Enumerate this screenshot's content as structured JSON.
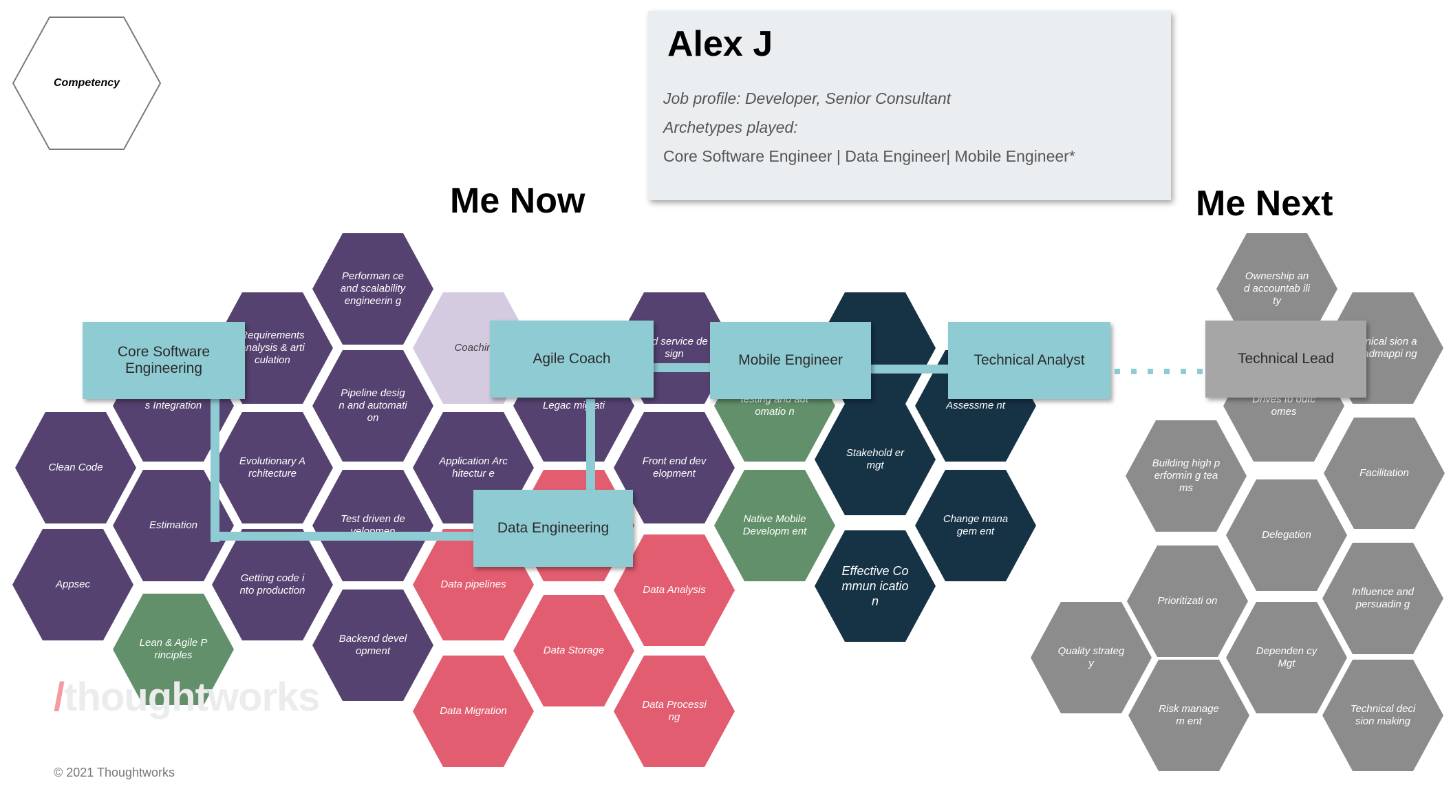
{
  "legend": {
    "label": "Competency"
  },
  "profile": {
    "name": "Alex J",
    "job_profile": "Job profile: Developer, Senior Consultant",
    "archetypes_label": "Archetypes played:",
    "archetypes": "Core Software Engineer | Data Engineer| Mobile Engineer*"
  },
  "headings": {
    "now": "Me Now",
    "next": "Me Next"
  },
  "colors": {
    "purple": "#564270",
    "pink": "#e25d6f",
    "green": "#62906a",
    "navy": "#163245",
    "gray": "#8c8c8c",
    "lilac": "#d5cbe1",
    "teal": "#8fcbd3"
  },
  "archetype_boxes": {
    "core_software_engineering": "Core Software Engineering",
    "agile_coach": "Agile Coach",
    "mobile_engineer": "Mobile Engineer",
    "technical_analyst": "Technical Analyst",
    "data_engineering": "Data Engineering",
    "technical_lead": "Technical Lead"
  },
  "competencies": [
    {
      "id": "performance",
      "label": "Performan ce and scalability engineerin g",
      "color": "purple"
    },
    {
      "id": "requirements",
      "label": "Requirements analysis & articulation",
      "color": "purple"
    },
    {
      "id": "coaching",
      "label": "Coachin",
      "color": "lilac"
    },
    {
      "id": "api-service-design",
      "label": "and service design",
      "color": "purple"
    },
    {
      "id": "navy-top",
      "label": "",
      "color": "navy"
    },
    {
      "id": "pipeline-design",
      "label": "Pipeline design and automation",
      "color": "purple"
    },
    {
      "id": "continuous-integration",
      "label": "s Integration",
      "color": "purple"
    },
    {
      "id": "legacy-migration",
      "label": "Legac migrati",
      "color": "purple"
    },
    {
      "id": "testing-automation",
      "label": "testing and automatio n",
      "color": "green"
    },
    {
      "id": "feasibility-assessment",
      "label": "Assessme nt",
      "color": "navy"
    },
    {
      "id": "clean-code",
      "label": "Clean Code",
      "color": "purple"
    },
    {
      "id": "evolutionary-architecture",
      "label": "Evolutionary Architecture",
      "color": "purple"
    },
    {
      "id": "application-architecture",
      "label": "Application Architectur e",
      "color": "purple"
    },
    {
      "id": "front-end",
      "label": "Front end development",
      "color": "purple"
    },
    {
      "id": "stakeholder-mgt",
      "label": "Stakehold er mgt",
      "color": "navy"
    },
    {
      "id": "estimation",
      "label": "Estimation",
      "color": "purple"
    },
    {
      "id": "tdd",
      "label": "Test driven developmen",
      "color": "purple"
    },
    {
      "id": "pink-mid",
      "label": "",
      "color": "pink"
    },
    {
      "id": "native-mobile",
      "label": "Native Mobile Developm ent",
      "color": "green"
    },
    {
      "id": "change-management",
      "label": "Change managem ent",
      "color": "navy"
    },
    {
      "id": "appsec",
      "label": "Appsec",
      "color": "purple"
    },
    {
      "id": "code-into-production",
      "label": "Getting code into production",
      "color": "purple"
    },
    {
      "id": "data-pipelines",
      "label": "Data pipelines",
      "color": "pink"
    },
    {
      "id": "data-analysis",
      "label": "Data Analysis",
      "color": "pink"
    },
    {
      "id": "effective-communication",
      "label": "Effective Commun ication",
      "color": "navy"
    },
    {
      "id": "lean-agile",
      "label": "Lean & Agile Principles",
      "color": "green"
    },
    {
      "id": "backend",
      "label": "Backend development",
      "color": "purple"
    },
    {
      "id": "data-storage",
      "label": "Data Storage",
      "color": "pink"
    },
    {
      "id": "data-migration",
      "label": "Data Migration",
      "color": "pink"
    },
    {
      "id": "data-processing",
      "label": "Data Processing",
      "color": "pink"
    },
    {
      "id": "ownership",
      "label": "Ownership and accountab ility",
      "color": "gray"
    },
    {
      "id": "technical-vision",
      "label": "echnical sion and admappi ng",
      "color": "gray"
    },
    {
      "id": "drives-outcomes",
      "label": "Drives to outcomes",
      "color": "gray"
    },
    {
      "id": "high-performing-teams",
      "label": "Building high performin g teams",
      "color": "gray"
    },
    {
      "id": "facilitation",
      "label": "Facilitation",
      "color": "gray"
    },
    {
      "id": "delegation",
      "label": "Delegation",
      "color": "gray"
    },
    {
      "id": "prioritization",
      "label": "Prioritizati on",
      "color": "gray"
    },
    {
      "id": "influence-persuading",
      "label": "Influence and persuadin g",
      "color": "gray"
    },
    {
      "id": "quality-strategy",
      "label": "Quality strategy",
      "color": "gray"
    },
    {
      "id": "dependency-mgt",
      "label": "Dependen cy Mgt",
      "color": "gray"
    },
    {
      "id": "risk-management",
      "label": "Risk managem ent",
      "color": "gray"
    },
    {
      "id": "technical-decision-making",
      "label": "Technical decision making",
      "color": "gray"
    }
  ],
  "watermark": {
    "slash": "/",
    "text": "thoughtworks"
  },
  "footer": {
    "copyright": "© 2021 Thoughtworks"
  }
}
